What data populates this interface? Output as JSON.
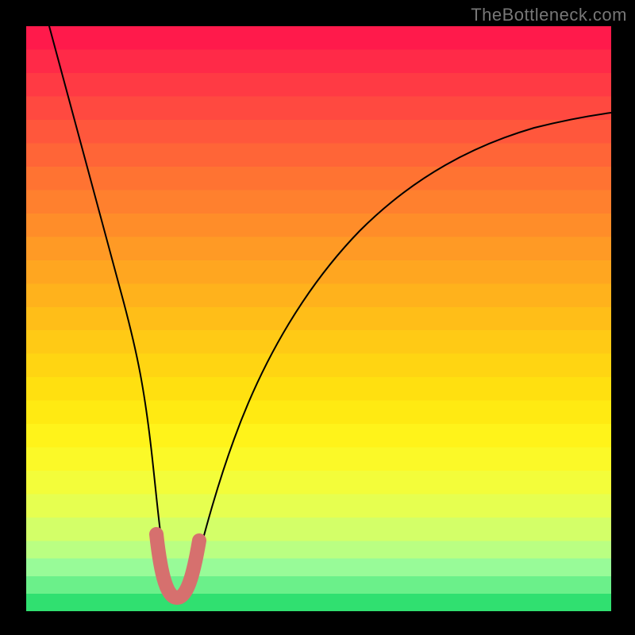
{
  "colors": {
    "page_bg": "#000000",
    "curve_stroke": "#000000",
    "trough_stroke": "#d6706e",
    "gradient_top": "#ff1a4b",
    "gradient_bottom": "#30e070"
  },
  "watermark": {
    "text": "TheBottleneck.com"
  },
  "chart_data": {
    "type": "line",
    "title": "",
    "xlabel": "",
    "ylabel": "",
    "xlim": [
      0,
      100
    ],
    "ylim": [
      0,
      100
    ],
    "note": "x is the horizontal position across the inner plot (0=left, 100=right). y is the curve height (0=bottom, 100=top). Values read off the rendered curve at regular x positions.",
    "series": [
      {
        "name": "bottleneck-curve",
        "x": [
          4,
          6,
          8,
          10,
          12,
          14,
          16,
          18,
          20,
          22,
          23,
          24,
          25,
          26,
          27,
          28,
          30,
          32,
          34,
          36,
          38,
          40,
          45,
          50,
          55,
          60,
          65,
          70,
          75,
          80,
          85,
          90,
          95,
          100
        ],
        "y": [
          100,
          90,
          80,
          71,
          62,
          53,
          44,
          36,
          27,
          18,
          13,
          8,
          5,
          4,
          4,
          5,
          9,
          15,
          22,
          28,
          33,
          38,
          48,
          55,
          61,
          66,
          70,
          73,
          76,
          78,
          80,
          82,
          83,
          84
        ]
      },
      {
        "name": "trough-highlight",
        "x": [
          22,
          23,
          24,
          25,
          26,
          27,
          28,
          29
        ],
        "y": [
          14,
          9,
          6,
          5,
          5,
          6,
          8,
          11
        ]
      }
    ],
    "background_gradient_axis": "vertical",
    "legend": null
  }
}
